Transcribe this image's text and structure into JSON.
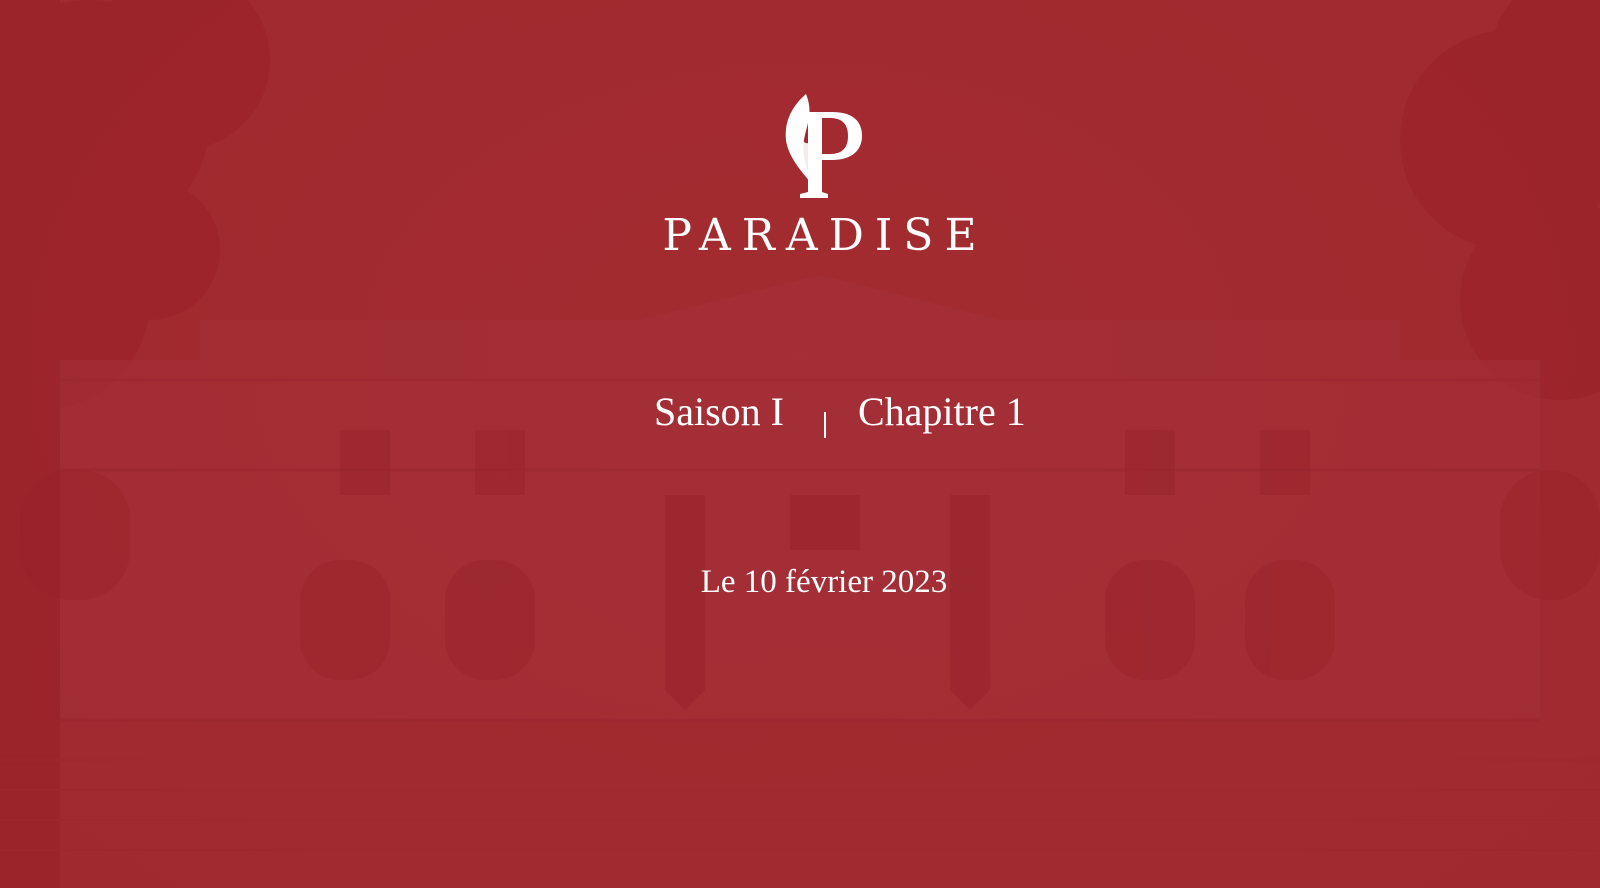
{
  "brand": {
    "name": "PARADISE",
    "logo_icon": "paradise-p-monogram-icon"
  },
  "episode": {
    "season": "Saison I",
    "separator": "|",
    "chapter": "Chapitre 1"
  },
  "date": "Le 10 février 2023",
  "colors": {
    "background": "#a22b30",
    "text": "#ffffff"
  }
}
